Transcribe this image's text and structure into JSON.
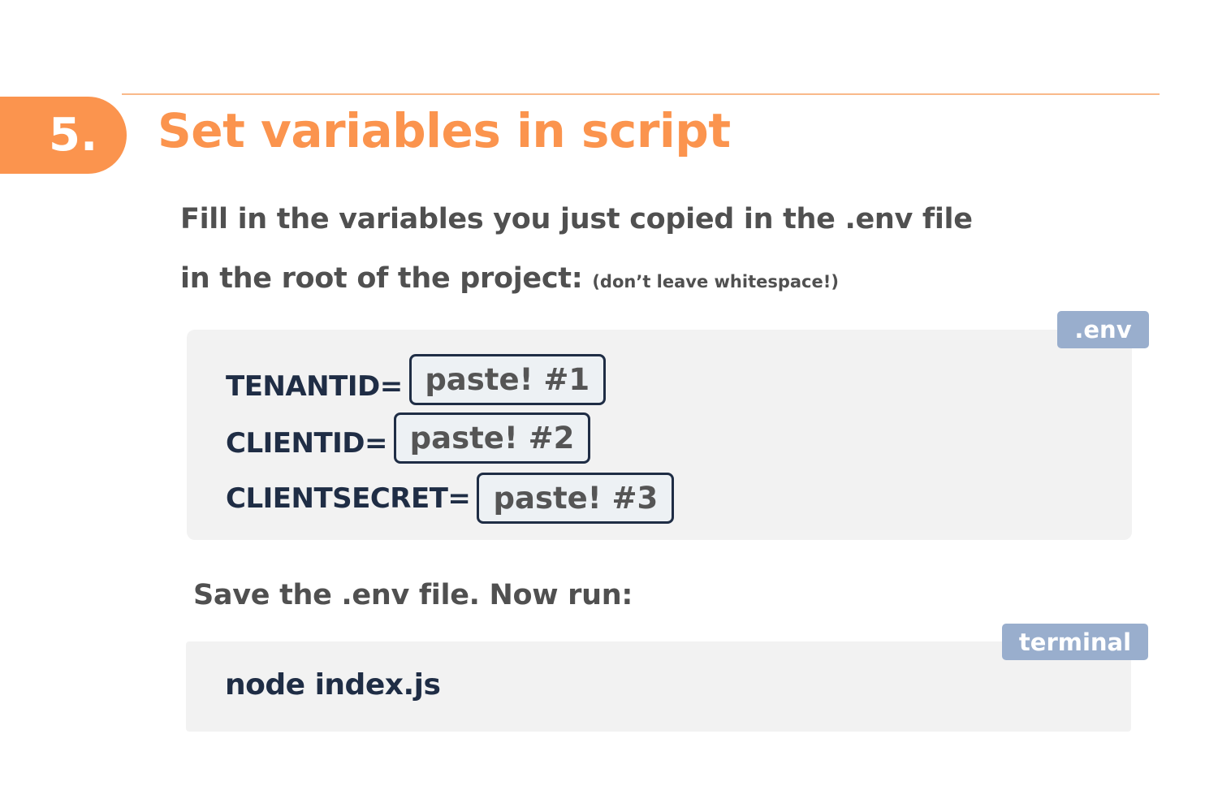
{
  "step": {
    "number": "5.",
    "title": "Set variables in script"
  },
  "instructions": {
    "line1": "Fill in the variables you just copied in the .env file",
    "line2": "in the root of the project:",
    "note": "(don’t leave whitespace!)"
  },
  "env_block": {
    "tag": ".env",
    "variables": [
      {
        "key": "TENANTID=",
        "placeholder": "paste! #1"
      },
      {
        "key": "CLIENTID=",
        "placeholder": "paste! #2"
      },
      {
        "key": "CLIENTSECRET=",
        "placeholder": "paste! #3"
      }
    ]
  },
  "save_instruction": "Save the .env file. Now run:",
  "terminal_block": {
    "tag": "terminal",
    "command": "node index.js"
  },
  "colors": {
    "accent": "#fb944e",
    "tag": "#99aecd",
    "code_text": "#1f2d45",
    "block_bg": "#f2f2f2"
  }
}
